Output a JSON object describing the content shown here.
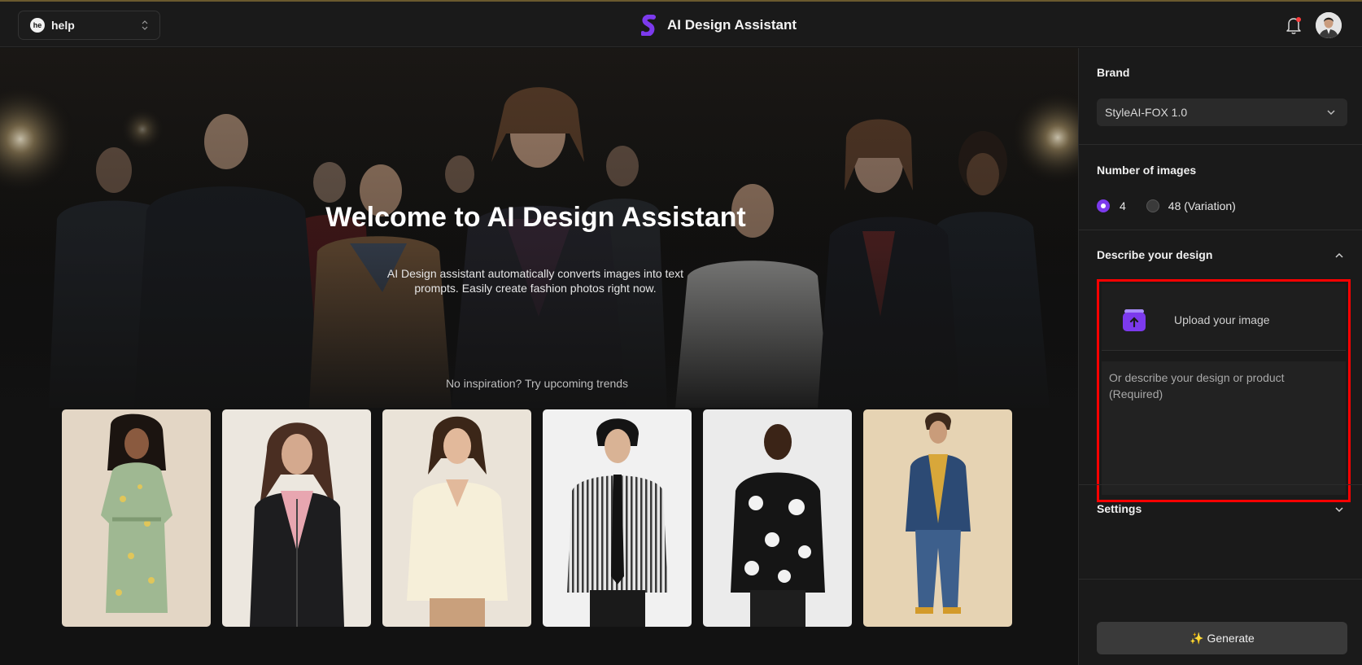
{
  "workspace": {
    "avatar_initials": "he",
    "name": "help"
  },
  "app": {
    "title": "AI Design Assistant",
    "accent": "#7c3aed"
  },
  "hero": {
    "title": "Welcome to AI Design Assistant",
    "subtitle": "AI Design assistant automatically converts images into text prompts. Easily create fashion photos right now.",
    "trends_label": "No inspiration? Try upcoming trends"
  },
  "trend_cards": [
    {
      "icon": "floral-wrap-dress-photo",
      "bg": "#e3d6c5"
    },
    {
      "icon": "leather-jacket-photo",
      "bg": "#ece7df"
    },
    {
      "icon": "cream-sweater-photo",
      "bg": "#eae3d8"
    },
    {
      "icon": "striped-shirt-tie-photo",
      "bg": "#f1f1f1"
    },
    {
      "icon": "floral-shirt-photo",
      "bg": "#ebebeb"
    },
    {
      "icon": "denim-jacket-photo",
      "bg": "#e6d3b3"
    }
  ],
  "panel": {
    "brand": {
      "label": "Brand",
      "selected": "StyleAI-FOX 1.0"
    },
    "num_images": {
      "label": "Number of images",
      "options": [
        {
          "label": "4",
          "selected": true
        },
        {
          "label": "48 (Variation)",
          "selected": false
        }
      ]
    },
    "describe": {
      "label": "Describe your design",
      "upload_label": "Upload your image",
      "placeholder": "Or describe your design or product (Required)",
      "value": ""
    },
    "settings": {
      "label": "Settings"
    },
    "generate": {
      "label": "✨ Generate"
    }
  },
  "colors": {
    "highlight_border": "#ff0000",
    "panel_bg": "#1a1a1a",
    "page_bg": "#141414"
  }
}
